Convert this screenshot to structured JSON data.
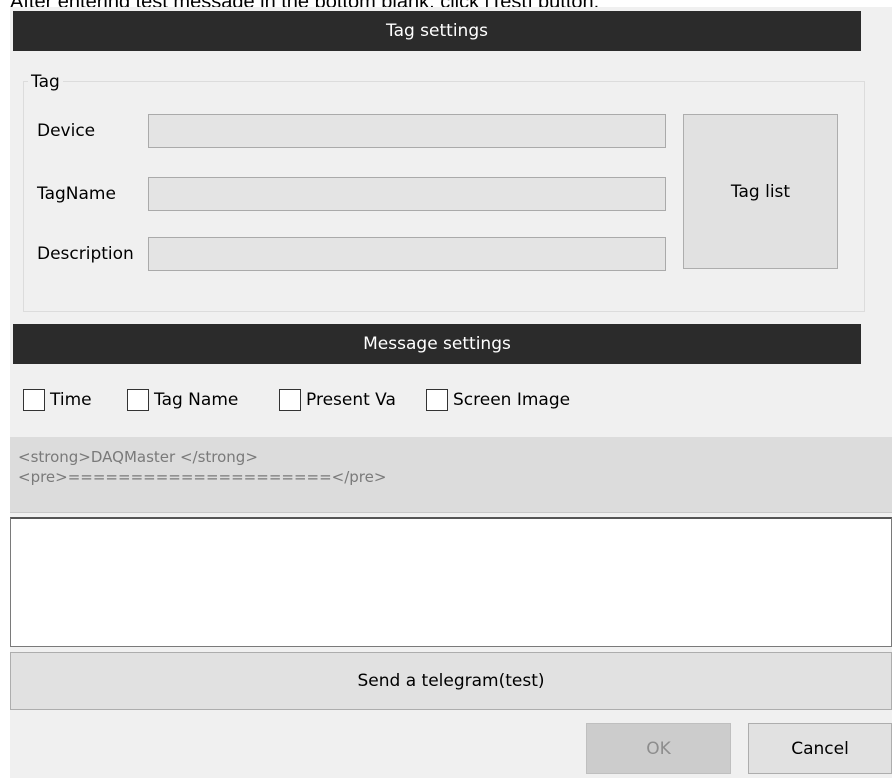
{
  "instruction": "After entering test message in the bottom blank, click [Test] button.",
  "tag_settings": {
    "header": "Tag settings",
    "group_title": "Tag",
    "fields": [
      {
        "label": "Device",
        "value": ""
      },
      {
        "label": "TagName",
        "value": ""
      },
      {
        "label": "Description",
        "value": ""
      }
    ],
    "tag_list_button": "Tag list"
  },
  "message_settings": {
    "header": "Message settings",
    "checkboxes": [
      {
        "label": "Time",
        "checked": false
      },
      {
        "label": "Tag Name",
        "checked": false
      },
      {
        "label": "Present Va",
        "checked": false
      },
      {
        "label": "Screen Image",
        "checked": false
      }
    ],
    "template_lines": [
      "<strong>DAQMaster </strong>",
      "<pre>=====================</pre>"
    ],
    "message_value": ""
  },
  "buttons": {
    "send": "Send a telegram(test)",
    "ok": "OK",
    "cancel": "Cancel"
  }
}
